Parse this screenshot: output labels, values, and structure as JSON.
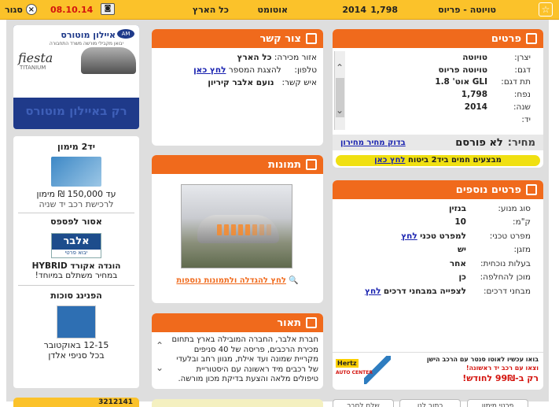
{
  "topbar": {
    "model": "טויוטה - פריוס",
    "engine": "1,798",
    "year": "2014",
    "gearbox": "אוטומט",
    "area": "כל הארץ",
    "date": "08.10.14",
    "close_label": "סגור",
    "close_x": "×",
    "fav_icon": "☆"
  },
  "details": {
    "title": "פרטים",
    "rows": [
      {
        "label": "יצרן:",
        "value": "טויוטה"
      },
      {
        "label": "דגם:",
        "value": "טויוטה פריוס"
      },
      {
        "label": "תת דגם:",
        "value": "GLI אוט' 1.8"
      },
      {
        "label": "נפח:",
        "value": "1,798"
      },
      {
        "label": "שנה:",
        "value": "2014"
      },
      {
        "label": "יד:",
        "value": ""
      }
    ],
    "price_label": "מחיר:",
    "price_value": "לא פורסם",
    "price_link": "בדוק מחיר מחירון",
    "promo_text": "מבצעים חמים ביד2 ביטוח",
    "promo_link": "לחץ כאן"
  },
  "contact": {
    "title": "צור קשר",
    "area_label": "אזור מכירה:",
    "area_value": "כל הארץ",
    "phone_label": "טלפון:",
    "phone_text": "להצגת המספר",
    "phone_link": "לחץ כאן",
    "person_label": "איש קשר:",
    "person_value": "נועם אלבר קיריון"
  },
  "photos": {
    "title": "תמונות",
    "enlarge_link": "לחץ להגדלה ולתמונות נוספות"
  },
  "description": {
    "title": "תאור",
    "text": "חברת אלבר, החברה המובילה בארץ בתחום מכירת הרכבים, פריסה של 40 סניפים מקריית שמונה ועד אילת, מגוון רחב ובלעדי של רכבים מיד ראשונה עם היסטוריית טיפולים מלאה והצעת בדיקת מכון מורשה. מגוון מסלולי מימון ,"
  },
  "more": {
    "title": "פרטים נוספים",
    "rows": [
      {
        "label": "סוג מנוע:",
        "value": "בנזין",
        "link": ""
      },
      {
        "label": "ק\"מ:",
        "value": "10",
        "link": ""
      },
      {
        "label": "מפרט טכני:",
        "value": "למפרט טכני",
        "link": "לחץ"
      },
      {
        "label": "מזגן:",
        "value": "יש",
        "link": ""
      },
      {
        "label": "בעלות נוכחית:",
        "value": "אחר",
        "link": ""
      },
      {
        "label": "מוכן להחלפה:",
        "value": "כן",
        "link": ""
      },
      {
        "label": "מבחני דרכים:",
        "value": "לצפייה במבחני דרכים",
        "link": "לחץ"
      }
    ]
  },
  "hertz": {
    "line1": "בואו עכשיו לאוטו סנטר עם הרכב הישן",
    "line2": "וצאו עם רכב יד ראשונה!",
    "line3": "רק ב-99₪ לחודש!",
    "logo": "Hertz",
    "logo_sub": "AUTO CENTER"
  },
  "ads": {
    "eylon_name": "איילון מוטורס",
    "eylon_sub": "יבואן מקבילי מורשה משרד התחבורה",
    "eylon_car": "fiesta",
    "eylon_car_sub": "TITANIUM",
    "eylon_slogan": "רק באיילון מוטורס",
    "yad2_title": "יד2 מימון",
    "yad2_line1": "עד 150,000 ₪ מימון",
    "yad2_line2": "לרכישת רכב יד שניה",
    "asor_title": "אסור לפספס",
    "albar_logo": "אלבר",
    "albar_sub": "יבוא פרטי",
    "asor_line1": "הונדה אקורד HYBRID",
    "asor_line2": "במחיר משתלם במיוחד!",
    "sukkot_title": "הפנינג סוכות",
    "sukkot_line1": "12-15 באוקטובר",
    "sukkot_line2": "בכל סניפי אלדן"
  },
  "bottom": {
    "tab1": "פרטי מימון",
    "tab2": "כתוב לנו",
    "tab3": "שלח לחבר",
    "left_text": "3212141"
  }
}
